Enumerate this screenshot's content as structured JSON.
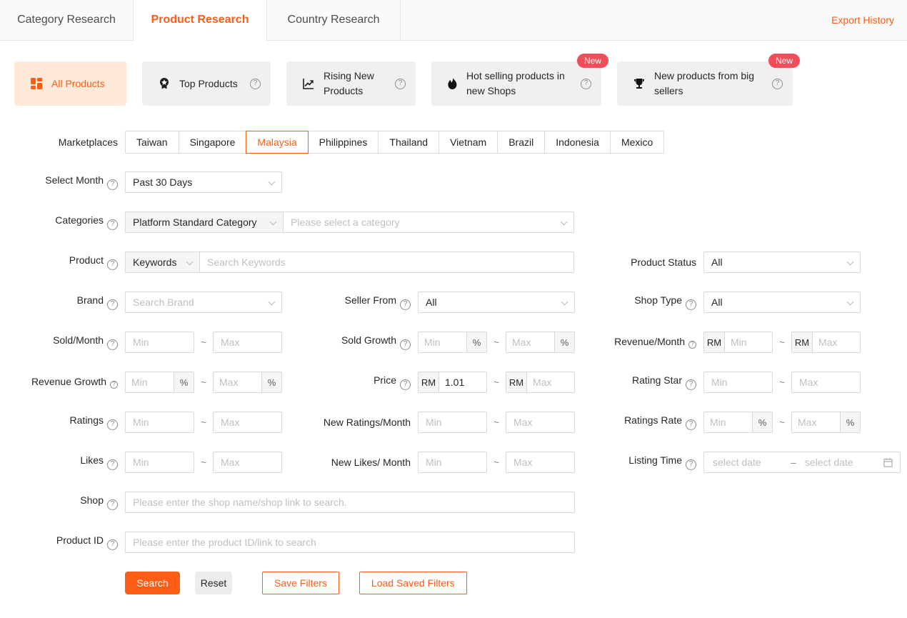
{
  "colors": {
    "primary": "#fd5c15",
    "card_active_bg": "#ffe9d9",
    "badge_bg": "#ef4e5a"
  },
  "header": {
    "tabs": [
      {
        "label": "Category Research"
      },
      {
        "label": "Product Research"
      },
      {
        "label": "Country Research"
      }
    ],
    "active_tab": "Product Research",
    "export_history_label": "Export History"
  },
  "product_types": {
    "all_products": {
      "label": "All Products"
    },
    "top_products": {
      "label": "Top Products"
    },
    "rising_new_products": {
      "label": "Rising New Products"
    },
    "hot_selling_new_shops": {
      "label": "Hot selling products in new Shops",
      "badge": "New"
    },
    "new_products_big_sellers": {
      "label": "New products from big sellers",
      "badge": "New"
    }
  },
  "filters": {
    "tilde": "~",
    "marketplaces": {
      "label": "Marketplaces",
      "options": [
        "Taiwan",
        "Singapore",
        "Malaysia",
        "Philippines",
        "Thailand",
        "Vietnam",
        "Brazil",
        "Indonesia",
        "Mexico"
      ],
      "selected": "Malaysia"
    },
    "select_month": {
      "label": "Select Month",
      "value": "Past 30 Days"
    },
    "categories": {
      "label": "Categories",
      "type_value": "Platform Standard Category",
      "category_placeholder": "Please select a category"
    },
    "product": {
      "label": "Product",
      "search_type": "Keywords",
      "placeholder": "Search Keywords"
    },
    "product_status": {
      "label": "Product Status",
      "value": "All"
    },
    "brand": {
      "label": "Brand",
      "placeholder": "Search Brand"
    },
    "seller_from": {
      "label": "Seller From",
      "value": "All"
    },
    "shop_type": {
      "label": "Shop Type",
      "value": "All"
    },
    "sold_month": {
      "label": "Sold/Month",
      "min": "Min",
      "max": "Max"
    },
    "sold_growth": {
      "label": "Sold Growth",
      "min": "Min",
      "max": "Max",
      "unit": "%"
    },
    "revenue_month": {
      "label": "Revenue/Month",
      "currency": "RM",
      "min": "Min",
      "max": "Max"
    },
    "revenue_growth": {
      "label": "Revenue Growth",
      "min": "Min",
      "max": "Max",
      "unit": "%"
    },
    "price": {
      "label": "Price",
      "currency": "RM",
      "min_value": "1.01",
      "max": "Max"
    },
    "rating_star": {
      "label": "Rating Star",
      "min": "Min",
      "max": "Max"
    },
    "ratings": {
      "label": "Ratings",
      "min": "Min",
      "max": "Max"
    },
    "new_ratings_month": {
      "label": "New Ratings/Month",
      "min": "Min",
      "max": "Max"
    },
    "ratings_rate": {
      "label": "Ratings Rate",
      "min": "Min",
      "max": "Max",
      "unit": "%"
    },
    "likes": {
      "label": "Likes",
      "min": "Min",
      "max": "Max"
    },
    "new_likes_month": {
      "label": "New Likes/ Month",
      "min": "Min",
      "max": "Max"
    },
    "listing_time": {
      "label": "Listing Time",
      "start_placeholder": "select date",
      "end_placeholder": "select date",
      "separator": "–"
    },
    "shop": {
      "label": "Shop",
      "placeholder": "Please enter the shop name/shop link to search."
    },
    "product_id": {
      "label": "Product ID",
      "placeholder": "Please enter the product ID/link to search"
    }
  },
  "actions": {
    "search": "Search",
    "reset": "Reset",
    "save_filters": "Save Filters",
    "load_saved_filters": "Load Saved Filters"
  }
}
